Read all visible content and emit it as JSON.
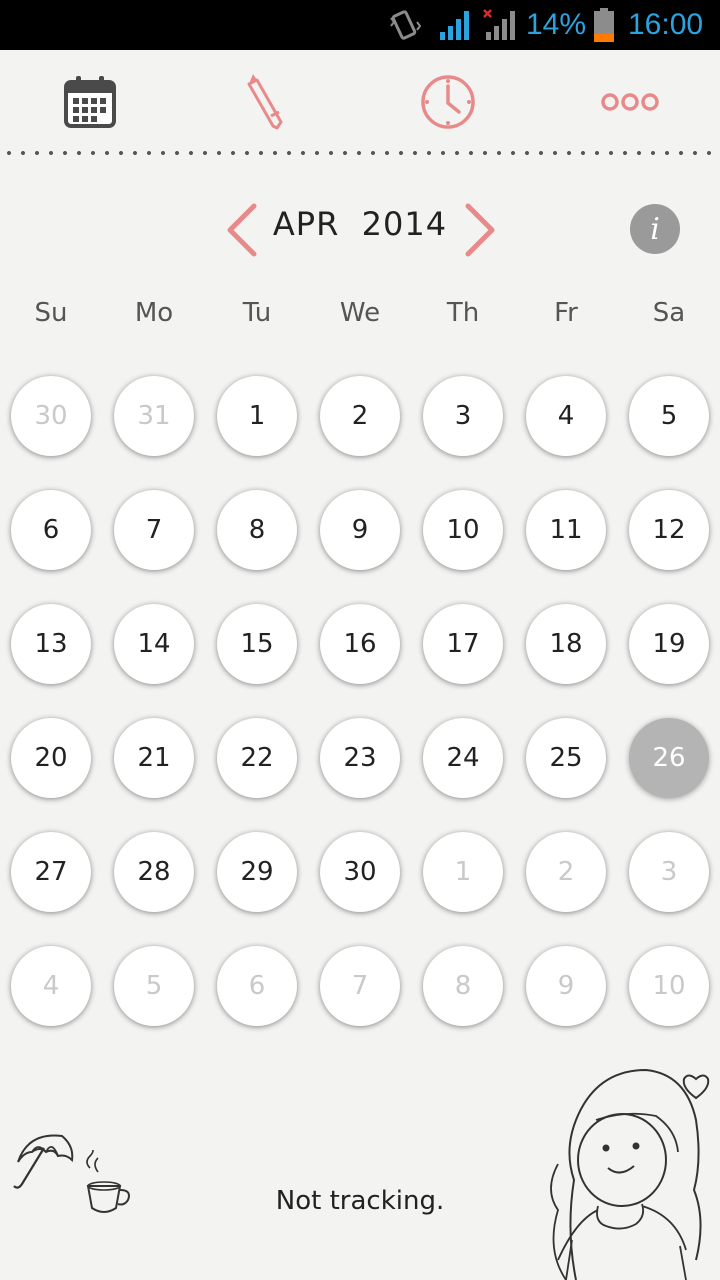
{
  "status_bar": {
    "battery_percent": "14%",
    "time": "16:00",
    "accent_color": "#2aa3e0"
  },
  "toolbar": {
    "items": [
      {
        "name": "calendar-icon"
      },
      {
        "name": "pencil-icon"
      },
      {
        "name": "clock-icon"
      },
      {
        "name": "more-icon"
      }
    ],
    "accent_color": "#e98a8a"
  },
  "header": {
    "month_year": "APR  2014",
    "info_glyph": "i"
  },
  "weekdays": [
    "Su",
    "Mo",
    "Tu",
    "We",
    "Th",
    "Fr",
    "Sa"
  ],
  "calendar": {
    "selected_day": "26",
    "weeks": [
      [
        {
          "day": "30",
          "muted": true
        },
        {
          "day": "31",
          "muted": true
        },
        {
          "day": "1"
        },
        {
          "day": "2"
        },
        {
          "day": "3"
        },
        {
          "day": "4"
        },
        {
          "day": "5"
        }
      ],
      [
        {
          "day": "6"
        },
        {
          "day": "7"
        },
        {
          "day": "8"
        },
        {
          "day": "9"
        },
        {
          "day": "10"
        },
        {
          "day": "11"
        },
        {
          "day": "12"
        }
      ],
      [
        {
          "day": "13"
        },
        {
          "day": "14"
        },
        {
          "day": "15"
        },
        {
          "day": "16"
        },
        {
          "day": "17"
        },
        {
          "day": "18"
        },
        {
          "day": "19"
        }
      ],
      [
        {
          "day": "20"
        },
        {
          "day": "21"
        },
        {
          "day": "22"
        },
        {
          "day": "23"
        },
        {
          "day": "24"
        },
        {
          "day": "25"
        },
        {
          "day": "26",
          "selected": true
        }
      ],
      [
        {
          "day": "27"
        },
        {
          "day": "28"
        },
        {
          "day": "29"
        },
        {
          "day": "30"
        },
        {
          "day": "1",
          "muted": true
        },
        {
          "day": "2",
          "muted": true
        },
        {
          "day": "3",
          "muted": true
        }
      ],
      [
        {
          "day": "4",
          "muted": true
        },
        {
          "day": "5",
          "muted": true
        },
        {
          "day": "6",
          "muted": true
        },
        {
          "day": "7",
          "muted": true
        },
        {
          "day": "8",
          "muted": true
        },
        {
          "day": "9",
          "muted": true
        },
        {
          "day": "10",
          "muted": true
        }
      ]
    ]
  },
  "footer": {
    "status": "Not tracking.",
    "decorations": [
      "umbrella-icon",
      "tea-cup-icon",
      "girl-illustration",
      "heart-icon"
    ]
  }
}
